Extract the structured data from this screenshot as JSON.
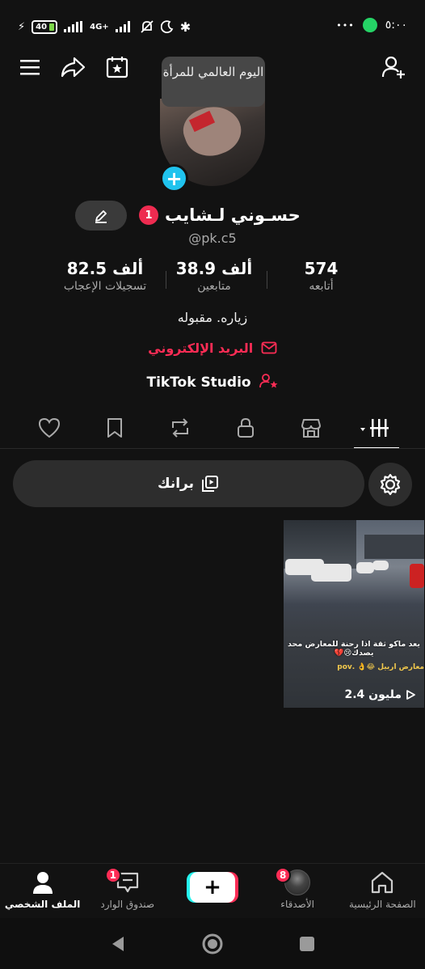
{
  "status_bar": {
    "battery": "40",
    "network": "4G+",
    "time": "٥:٠٠",
    "more": "•••"
  },
  "top_bar": {
    "tooltip": "اليوم العالمي للمرأة"
  },
  "profile": {
    "notification_count": "1",
    "name": "حسـوني لـشايب",
    "handle": "@pk.c5",
    "bio": "زياره. مقبوله",
    "email_label": "البريد الإلكتروني",
    "studio_label": "TikTok Studio"
  },
  "stats": {
    "likes_value": "82.5 ألف",
    "likes_label": "تسجيلات الإعجاب",
    "followers_value": "38.9 ألف",
    "followers_label": "متابعين",
    "following_value": "574",
    "following_label": "أتابعه"
  },
  "brank_label": "برانك",
  "video": {
    "caption": "يعد ماكو ثقة اذا رحنة للمعارض محد يصدك😢💔",
    "caption2": "معارض اربيل 😂👌 .pov",
    "views": "2.4 مليون"
  },
  "bottom_nav": {
    "home": "الصفحة الرئيسية",
    "friends": "الأصدقاء",
    "friends_badge": "8",
    "create": "+",
    "inbox": "صندوق الوارد",
    "inbox_badge": "1",
    "profile": "الملف الشخصي"
  },
  "colors": {
    "accent": "#fe2c55",
    "cyan": "#25f4ee",
    "background": "#121212"
  }
}
